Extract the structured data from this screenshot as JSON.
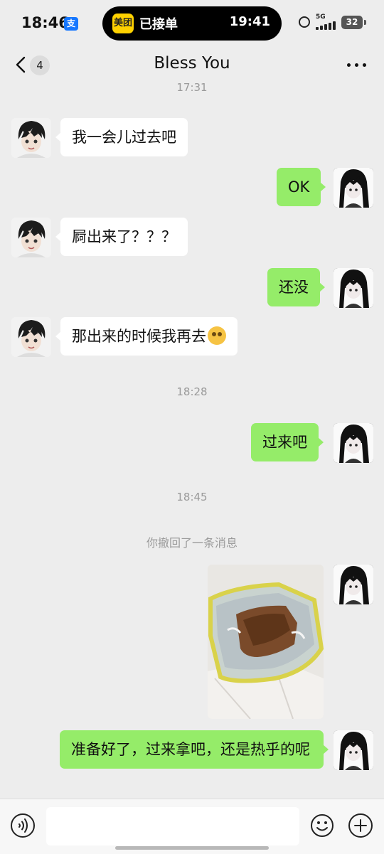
{
  "status_bar": {
    "time": "18:46",
    "alipay_glyph": "支",
    "island": {
      "app_logo_text": "美团",
      "text": "已接单",
      "time": "19:41"
    },
    "network": "5G",
    "battery": "32",
    "icons": [
      "alipay-icon",
      "alarm-icon",
      "signal-icon",
      "battery-icon"
    ]
  },
  "header": {
    "unread_count": "4",
    "title": "Bless You",
    "icons": [
      "back-icon",
      "more-icon"
    ]
  },
  "chat": {
    "timestamps": [
      "17:31",
      "18:28",
      "18:45"
    ],
    "recall_notice": "你撤回了一条消息",
    "messages": [
      {
        "sender": "contact",
        "text": "我一会儿过去吧"
      },
      {
        "sender": "me",
        "text": "OK"
      },
      {
        "sender": "contact",
        "text": "屙出来了？？？"
      },
      {
        "sender": "me",
        "text": "还没"
      },
      {
        "sender": "contact",
        "text": "那出来的时候我再去",
        "emoji": "pleading-face-emoji"
      },
      {
        "sender": "me",
        "text": "过来吧"
      },
      {
        "sender": "me",
        "type": "image"
      },
      {
        "sender": "me",
        "text": "准备好了，过来拿吧，还是热乎的呢"
      }
    ]
  },
  "input_bar": {
    "placeholder": "",
    "icons": [
      "voice-icon",
      "emoji-icon",
      "plus-icon"
    ]
  },
  "colors": {
    "background": "#ededed",
    "outgoing_bubble": "#95ec69",
    "incoming_bubble": "#ffffff",
    "timestamp_text": "#9a9a9a",
    "island_logo": "#ffd100"
  }
}
